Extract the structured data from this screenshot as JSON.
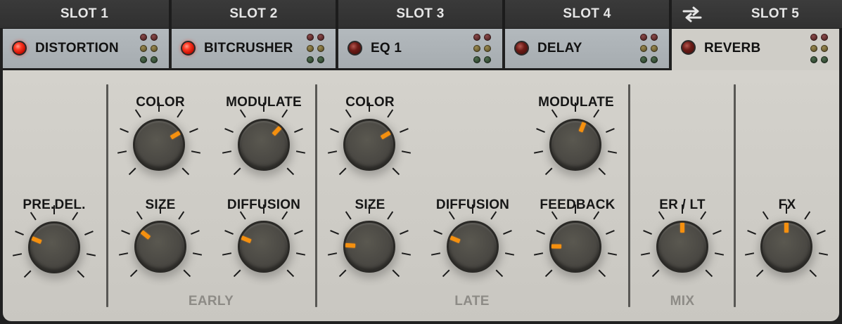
{
  "header": {
    "slots": [
      {
        "label": "SLOT 1",
        "effect": "DISTORTION",
        "led": "on",
        "active": false
      },
      {
        "label": "SLOT 2",
        "effect": "BITCRUSHER",
        "led": "on",
        "active": false
      },
      {
        "label": "SLOT 3",
        "effect": "EQ 1",
        "led": "off",
        "active": false
      },
      {
        "label": "SLOT 4",
        "effect": "DELAY",
        "led": "off",
        "active": false
      },
      {
        "label": "SLOT 5",
        "effect": "REVERB",
        "led": "off",
        "active": true
      }
    ],
    "swap_icon": "swap-arrows-icon"
  },
  "colors": {
    "panel": "#cfcdc7",
    "pointer": "#f5900f",
    "led_on": "#ff3a24",
    "section_label": "#8d8b86"
  },
  "knobs": {
    "pre_delay": {
      "label": "PRE.DEL.",
      "level": 0.25
    },
    "early_color": {
      "label": "COLOR",
      "level": 0.72
    },
    "early_modulate": {
      "label": "MODULATE",
      "level": 0.66
    },
    "early_size": {
      "label": "SIZE",
      "level": 0.31
    },
    "early_diffusion": {
      "label": "DIFFUSION",
      "level": 0.25
    },
    "late_color": {
      "label": "COLOR",
      "level": 0.72
    },
    "late_modulate": {
      "label": "MODULATE",
      "level": 0.58
    },
    "late_size": {
      "label": "SIZE",
      "level": 0.18
    },
    "late_diffusion": {
      "label": "DIFFUSION",
      "level": 0.25
    },
    "late_feedback": {
      "label": "FEEDBACK",
      "level": 0.17
    },
    "mix_er_lt": {
      "label": "ER / LT",
      "level": 0.5
    },
    "mix_fx": {
      "label": "FX",
      "level": 0.5
    }
  },
  "sections": {
    "early": "EARLY",
    "late": "LATE",
    "mix": "MIX"
  }
}
